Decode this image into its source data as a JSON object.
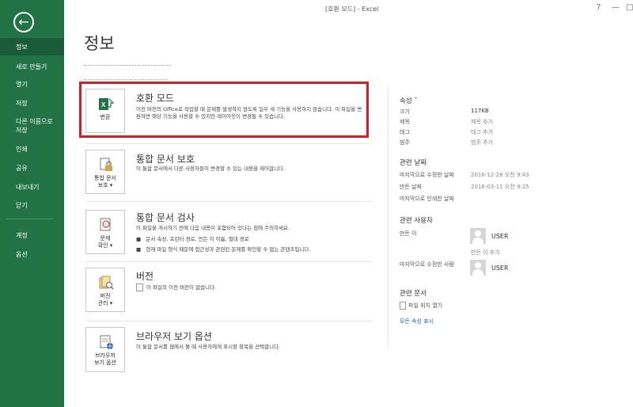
{
  "window": {
    "title": "[호환 모드] - Excel",
    "help_glyph": "?",
    "minimize_glyph": "—",
    "restore_glyph": "□"
  },
  "sidebar": {
    "back_glyph": "←",
    "items": [
      {
        "label": "정보"
      },
      {
        "label": "새로 만들기"
      },
      {
        "label": "열기"
      },
      {
        "label": "저장"
      },
      {
        "label": "다른 이름으로\n저장"
      },
      {
        "label": "인쇄"
      },
      {
        "label": "공유"
      },
      {
        "label": "내보내기"
      },
      {
        "label": "닫기"
      },
      {
        "label": "계정"
      },
      {
        "label": "옵션"
      }
    ]
  },
  "main": {
    "title": "정보",
    "sections": [
      {
        "button": "변환",
        "title": "호환 모드",
        "desc": "이전 버전의 Office로 작업할 때 문제를 발생하지 않도록 일부 새 기능을 사용하지 않습니다. 이 파일을 변환하면 해당 기능을 사용할 수 있지만 레이아웃이 변경될 수 있습니다."
      },
      {
        "button": "통합 문서\n보호 ▾",
        "title": "통합 문서 보호",
        "desc": "이 통합 문서에서 다른 사용자들이 변경할 수 있는 내용을 제어합니다."
      },
      {
        "button": "문제\n확인 ▾",
        "title": "통합 문서 검사",
        "desc": "이 파일을 게시하기 전에 다음 내용이 포함되어 있다는 점에 주의하세요.",
        "bullets": [
          "문서 속성, 프린터 경로, 만든 이 이름, 절대 경로",
          "현재 파일 형식 때문에 접근성과 관련된 문제를 확인할 수 없는 콘텐츠입니다."
        ]
      },
      {
        "button": "버전\n관리 ▾",
        "title": "버전",
        "desc": "이 파일의 이전 버전이 없습니다."
      },
      {
        "button": "브라우저\n보기 옵션",
        "title": "브라우저 보기 옵션",
        "desc": "이 통합 문서를 웹에서 볼 때 사용자에게 표시할 항목을 선택합니다."
      }
    ]
  },
  "properties": {
    "heading": "속성 ˇ",
    "rows": [
      {
        "label": "크기",
        "value": "117KB"
      },
      {
        "label": "제목",
        "value": "제목 추가"
      },
      {
        "label": "태그",
        "value": "태그 추가"
      },
      {
        "label": "범주",
        "value": "범주 추가"
      }
    ],
    "dates_heading": "관련 날짜",
    "dates": [
      {
        "label": "마지막으로 수정한 날짜",
        "value": "2016-12-28 오전 9:43"
      },
      {
        "label": "만든 날짜",
        "value": "2016-03-11 오전 9:25"
      },
      {
        "label": "마지막으로 인쇄한 날짜",
        "value": ""
      }
    ],
    "people_heading": "관련 사용자",
    "author_label": "만든 이",
    "author_name": "USER",
    "add_author": "만든 이 추가",
    "modified_by_label": "마지막으로 수정한 사람",
    "modified_by_name": "USER",
    "docs_heading": "관련 문서",
    "open_location": "파일 위치 열기",
    "show_all": "모든 속성 표시"
  },
  "colors": {
    "accent": "#217346",
    "highlight_box": "#d51f26"
  }
}
